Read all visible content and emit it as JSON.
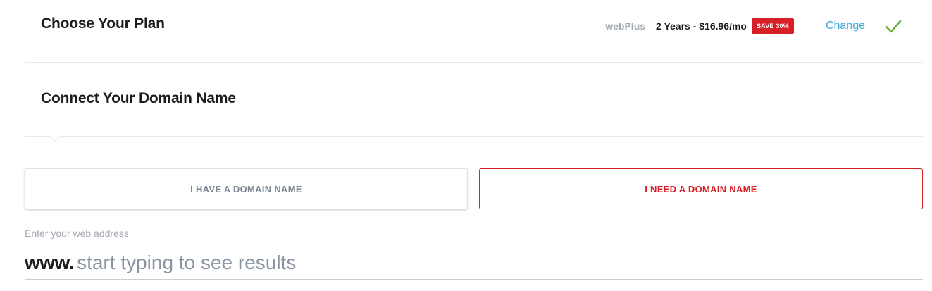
{
  "plan_section": {
    "title": "Choose Your Plan",
    "plan_name": "webPlus",
    "plan_price": "2 Years - $16.96/mo",
    "save_badge": "SAVE 30%",
    "change_label": "Change",
    "status_icon": "check-icon"
  },
  "domain_section": {
    "title": "Connect Your Domain Name",
    "options": [
      {
        "label": "I HAVE A DOMAIN NAME",
        "selected": false
      },
      {
        "label": "I NEED A DOMAIN NAME",
        "selected": true
      }
    ],
    "field_label": "Enter your web address",
    "prefix": "www.",
    "input_value": "",
    "input_placeholder": "start typing to see results"
  },
  "colors": {
    "accent_red": "#d71f27",
    "link_blue": "#3aa7d8",
    "check_green": "#6cae3e",
    "muted_text": "#a3a9b1"
  }
}
